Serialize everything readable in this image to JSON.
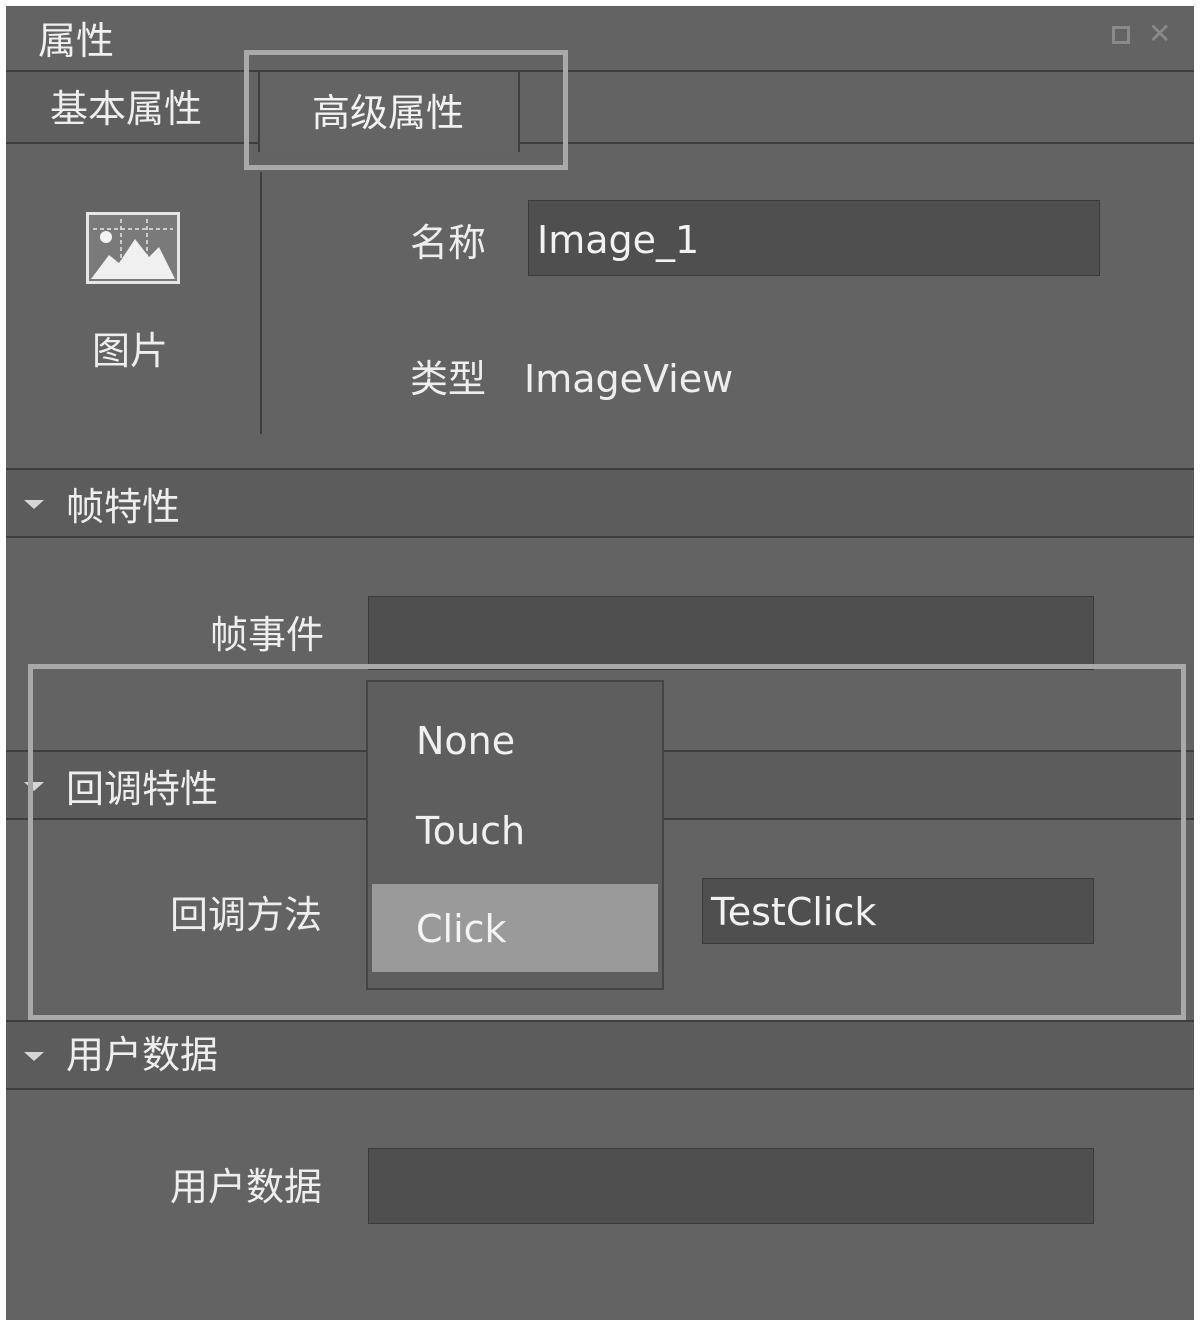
{
  "panel": {
    "title": "属性",
    "window_controls": [
      "restore-icon",
      "close-icon"
    ]
  },
  "tabs": [
    {
      "label": "基本属性",
      "active": false
    },
    {
      "label": "高级属性",
      "active": true
    }
  ],
  "object": {
    "icon": "image-icon",
    "caption": "图片",
    "name_label": "名称",
    "name_value": "Image_1",
    "type_label": "类型",
    "type_value": "ImageView"
  },
  "frame_section": {
    "header": "帧特性",
    "frame_event_label": "帧事件",
    "frame_event_value": ""
  },
  "callback_section": {
    "header": "回调特性",
    "method_label": "回调方法",
    "dropdown_options": [
      "None",
      "Touch",
      "Click"
    ],
    "selected_option": "Click",
    "method_value": "TestClick"
  },
  "user_section": {
    "header": "用户数据",
    "user_data_label": "用户数据",
    "user_data_value": ""
  },
  "colors": {
    "panel_bg": "#636363",
    "field_bg": "#4f4f4f",
    "highlight_border": "#a9a9a9",
    "selected_option_bg": "#9a9a9a"
  }
}
